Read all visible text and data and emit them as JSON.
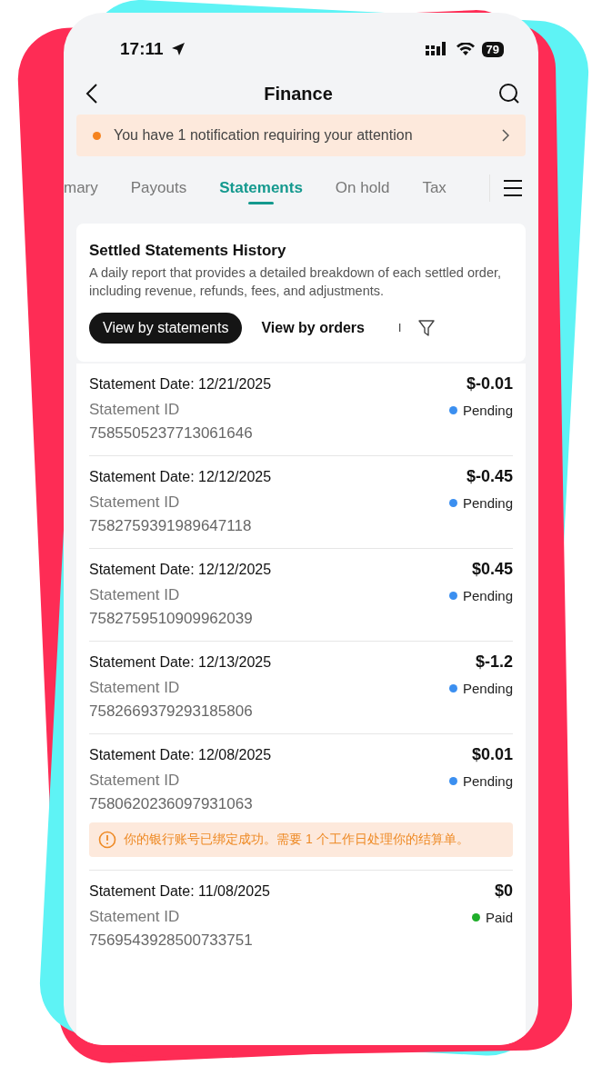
{
  "status_bar": {
    "time": "17:11",
    "battery": "79"
  },
  "header": {
    "title": "Finance"
  },
  "notification": {
    "text": "You have 1 notification requiring your attention"
  },
  "tabs": [
    {
      "label": "mary",
      "selected": false
    },
    {
      "label": "Payouts",
      "selected": false
    },
    {
      "label": "Statements",
      "selected": true
    },
    {
      "label": "On hold",
      "selected": false
    },
    {
      "label": "Tax",
      "selected": false
    }
  ],
  "history": {
    "title": "Settled Statements History",
    "description": "A daily report that provides a detailed breakdown of each settled order, including revenue, refunds, fees, and adjustments.",
    "views": [
      {
        "label": "View by statements",
        "selected": true
      },
      {
        "label": "View by orders",
        "selected": false
      }
    ],
    "separator": "I"
  },
  "statements": [
    {
      "date": "Statement Date: 12/21/2025",
      "amount": "$-0.01",
      "id_label": "Statement ID",
      "id": "7585505237713061646",
      "status": "Pending",
      "color": "#3b8ff0"
    },
    {
      "date": "Statement Date: 12/12/2025",
      "amount": "$-0.45",
      "id_label": "Statement ID",
      "id": "7582759391989647118",
      "status": "Pending",
      "color": "#3b8ff0"
    },
    {
      "date": "Statement Date: 12/12/2025",
      "amount": "$0.45",
      "id_label": "Statement ID",
      "id": "7582759510909962039",
      "status": "Pending",
      "color": "#3b8ff0"
    },
    {
      "date": "Statement Date: 12/13/2025",
      "amount": "$-1.2",
      "id_label": "Statement ID",
      "id": "7582669379293185806",
      "status": "Pending",
      "color": "#3b8ff0"
    },
    {
      "date": "Statement Date: 12/08/2025",
      "amount": "$0.01",
      "id_label": "Statement ID",
      "id": "7580620236097931063",
      "status": "Pending",
      "color": "#3b8ff0",
      "notice": "你的银行账号已绑定成功。需要 1 个工作日处理你的结算单。"
    },
    {
      "date": "Statement Date: 11/08/2025",
      "amount": "$0",
      "id_label": "Statement ID",
      "id": "7569543928500733751",
      "status": "Paid",
      "color": "#1fae2a"
    }
  ]
}
